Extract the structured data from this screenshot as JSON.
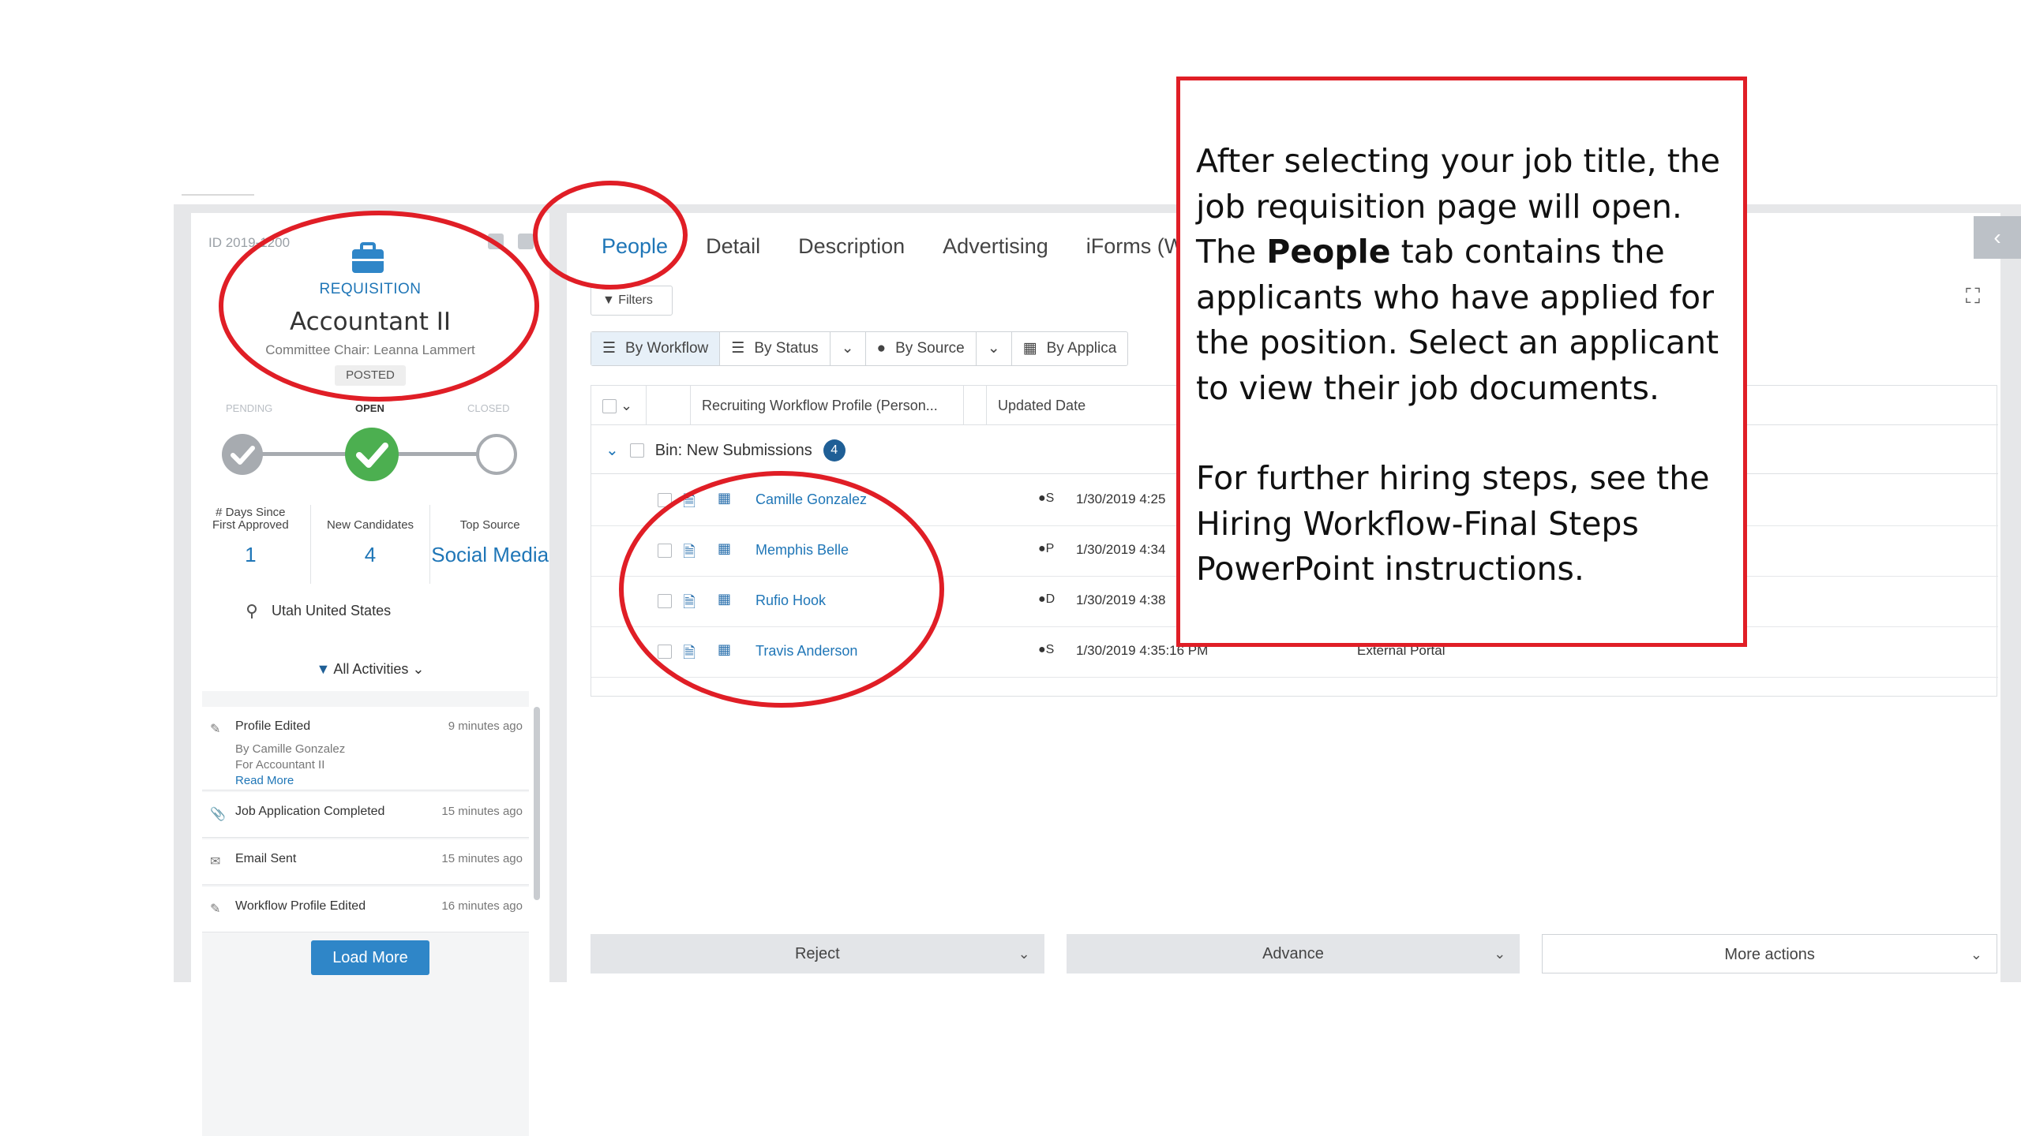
{
  "requisition": {
    "id": "ID 2019-1200",
    "label": "REQUISITION",
    "title": "Accountant II",
    "chair": "Committee Chair: Leanna Lammert",
    "status": "POSTED"
  },
  "stages": {
    "pending": "PENDING",
    "open": "OPEN",
    "closed": "CLOSED"
  },
  "stats": [
    {
      "label_line1": "# Days Since",
      "label_line2": "First Approved",
      "value": "1"
    },
    {
      "label_line1": "",
      "label_line2": "New Candidates",
      "value": "4"
    },
    {
      "label_line1": "",
      "label_line2": "Top Source",
      "value": "Social Media"
    }
  ],
  "location": "Utah United States",
  "activities_filter": "All Activities",
  "feed": [
    {
      "title": "Profile Edited",
      "time": "9 minutes ago",
      "by": "By Camille Gonzalez",
      "for": "For Accountant II",
      "link": "Read More",
      "icon": "edit-icon"
    },
    {
      "title": "Job Application Completed",
      "time": "15 minutes ago",
      "icon": "paperclip-icon"
    },
    {
      "title": "Email Sent",
      "time": "15 minutes ago",
      "icon": "envelope-icon"
    },
    {
      "title": "Workflow Profile Edited",
      "time": "16 minutes ago",
      "icon": "edit-icon"
    }
  ],
  "load_more": "Load More",
  "tabs": [
    "People",
    "Detail",
    "Description",
    "Advertising",
    "iForms (W"
  ],
  "filters_label": "Filters",
  "views": [
    "By Workflow",
    "By Status",
    "By Source",
    "By Applica"
  ],
  "grid": {
    "col_profile": "Recruiting Workflow Profile (Person...",
    "col_updated": "Updated Date",
    "bin_label": "Bin: New Submissions",
    "bin_count": "4",
    "rows": [
      {
        "name": "Camille Gonzalez",
        "source": "S",
        "date": "1/30/2019 4:25",
        "portal": ""
      },
      {
        "name": "Memphis Belle",
        "source": "P",
        "date": "1/30/2019 4:34",
        "portal": ""
      },
      {
        "name": "Rufio Hook",
        "source": "D",
        "date": "1/30/2019 4:38",
        "portal": ""
      },
      {
        "name": "Travis Anderson",
        "source": "S",
        "date": "1/30/2019 4:35:16 PM",
        "portal": "External Portal"
      }
    ]
  },
  "footer": {
    "reject": "Reject",
    "advance": "Advance",
    "more": "More actions"
  },
  "callout": {
    "p1_before": "After selecting your job title, the job requisition page will open. The ",
    "p1_bold": "People",
    "p1_after": " tab contains the applicants who have applied for the position. Select an applicant to view their job documents.",
    "p2": "For further hiring steps, see the Hiring Workflow-Final Steps PowerPoint instructions."
  },
  "colors": {
    "accent": "#1f76b7",
    "highlight": "#e01e26",
    "success": "#4caf50"
  }
}
